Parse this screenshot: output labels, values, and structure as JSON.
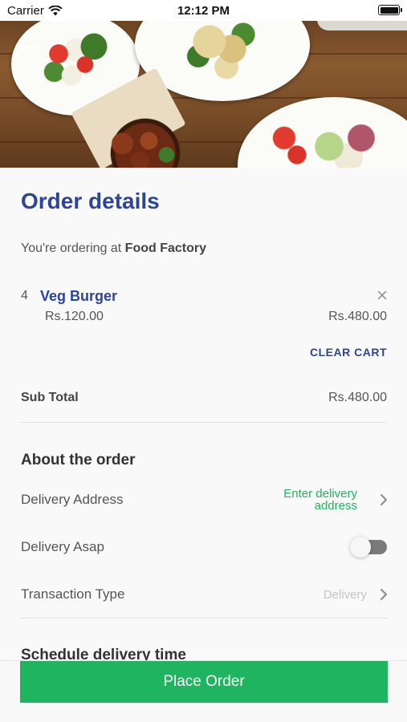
{
  "status_bar": {
    "carrier": "Carrier",
    "time": "12:12 PM"
  },
  "page": {
    "title": "Order details",
    "ordering_prefix": "You're ordering at",
    "restaurant": "Food Factory"
  },
  "cart": {
    "items": [
      {
        "qty": "4",
        "name": "Veg Burger",
        "unit_price": "Rs.120.00",
        "total": "Rs.480.00"
      }
    ],
    "clear_label": "CLEAR CART",
    "subtotal_label": "Sub Total",
    "subtotal_value": "Rs.480.00"
  },
  "about": {
    "title": "About the order",
    "delivery_address_label": "Delivery Address",
    "delivery_address_value_line1": "Enter delivery",
    "delivery_address_value_line2": "address",
    "delivery_asap_label": "Delivery Asap",
    "delivery_asap_enabled": false,
    "transaction_type_label": "Transaction Type",
    "transaction_type_value": "Delivery"
  },
  "schedule": {
    "title": "Schedule delivery time"
  },
  "footer": {
    "place_order_label": "Place Order"
  },
  "colors": {
    "brand_blue": "#2d4596",
    "accent_green": "#1fb45f"
  },
  "icons": {
    "back": "arrow-left-icon",
    "remove": "close-icon",
    "row_nav": "chevron-right-icon"
  }
}
